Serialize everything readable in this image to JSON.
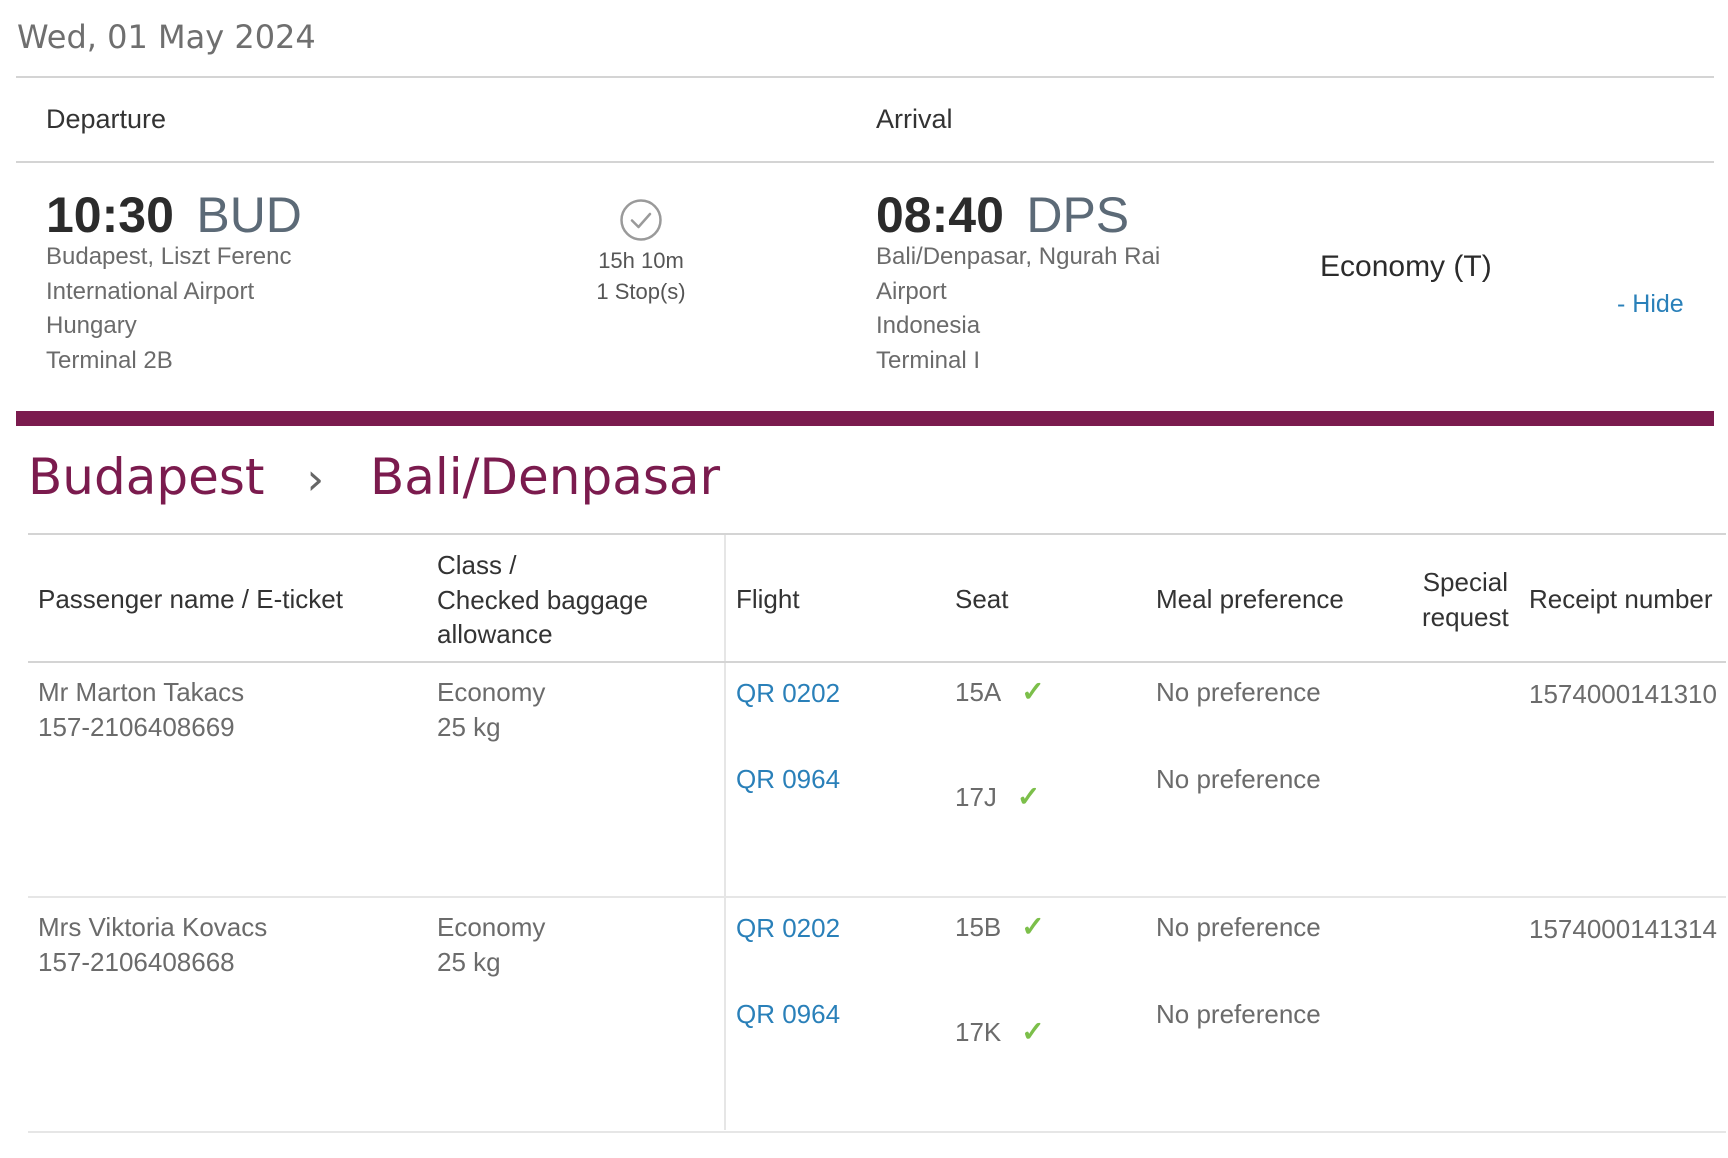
{
  "date": "Wed, 01 May 2024",
  "header": {
    "departure_label": "Departure",
    "arrival_label": "Arrival"
  },
  "departure": {
    "time": "10:30",
    "code": "BUD",
    "address": [
      "Budapest, Liszt Ferenc",
      "International Airport",
      "Hungary",
      "Terminal 2B"
    ]
  },
  "duration": {
    "time": "15h 10m",
    "stops": "1 Stop(s)"
  },
  "arrival": {
    "time": "08:40",
    "code": "DPS",
    "address": [
      "Bali/Denpasar, Ngurah Rai",
      "Airport",
      "Indonesia",
      "Terminal I"
    ]
  },
  "cabin": "Economy (T)",
  "hide_label": "- Hide",
  "route": {
    "from": "Budapest",
    "separator": "›",
    "to": "Bali/Denpasar"
  },
  "table": {
    "headers": {
      "passenger": "Passenger name / E-ticket",
      "class": [
        "Class /",
        "Checked baggage",
        "allowance"
      ],
      "flight": "Flight",
      "seat": "Seat",
      "meal": "Meal preference",
      "special": [
        "Special",
        "request"
      ],
      "receipt": "Receipt number"
    },
    "rows": [
      {
        "name": "Mr Marton Takacs",
        "ticket": "157-2106408669",
        "class": "Economy",
        "baggage": "25 kg",
        "receipt": "1574000141310",
        "flights": [
          {
            "flight": "QR 0202",
            "seat": "15A",
            "meal": "No preference"
          },
          {
            "flight": "QR 0964",
            "seat": "17J",
            "meal": "No preference"
          }
        ]
      },
      {
        "name": "Mrs Viktoria Kovacs",
        "ticket": "157-2106408668",
        "class": "Economy",
        "baggage": "25 kg",
        "receipt": "1574000141314",
        "flights": [
          {
            "flight": "QR 0202",
            "seat": "15B",
            "meal": "No preference"
          },
          {
            "flight": "QR 0964",
            "seat": "17K",
            "meal": "No preference"
          }
        ]
      }
    ]
  },
  "colors": {
    "brand": "#7b1b4e",
    "link": "#2a80b9",
    "check": "#7cbf4a"
  },
  "icons": {
    "stop": "clock-check-icon",
    "seat_confirmed": "checkmark-icon"
  }
}
